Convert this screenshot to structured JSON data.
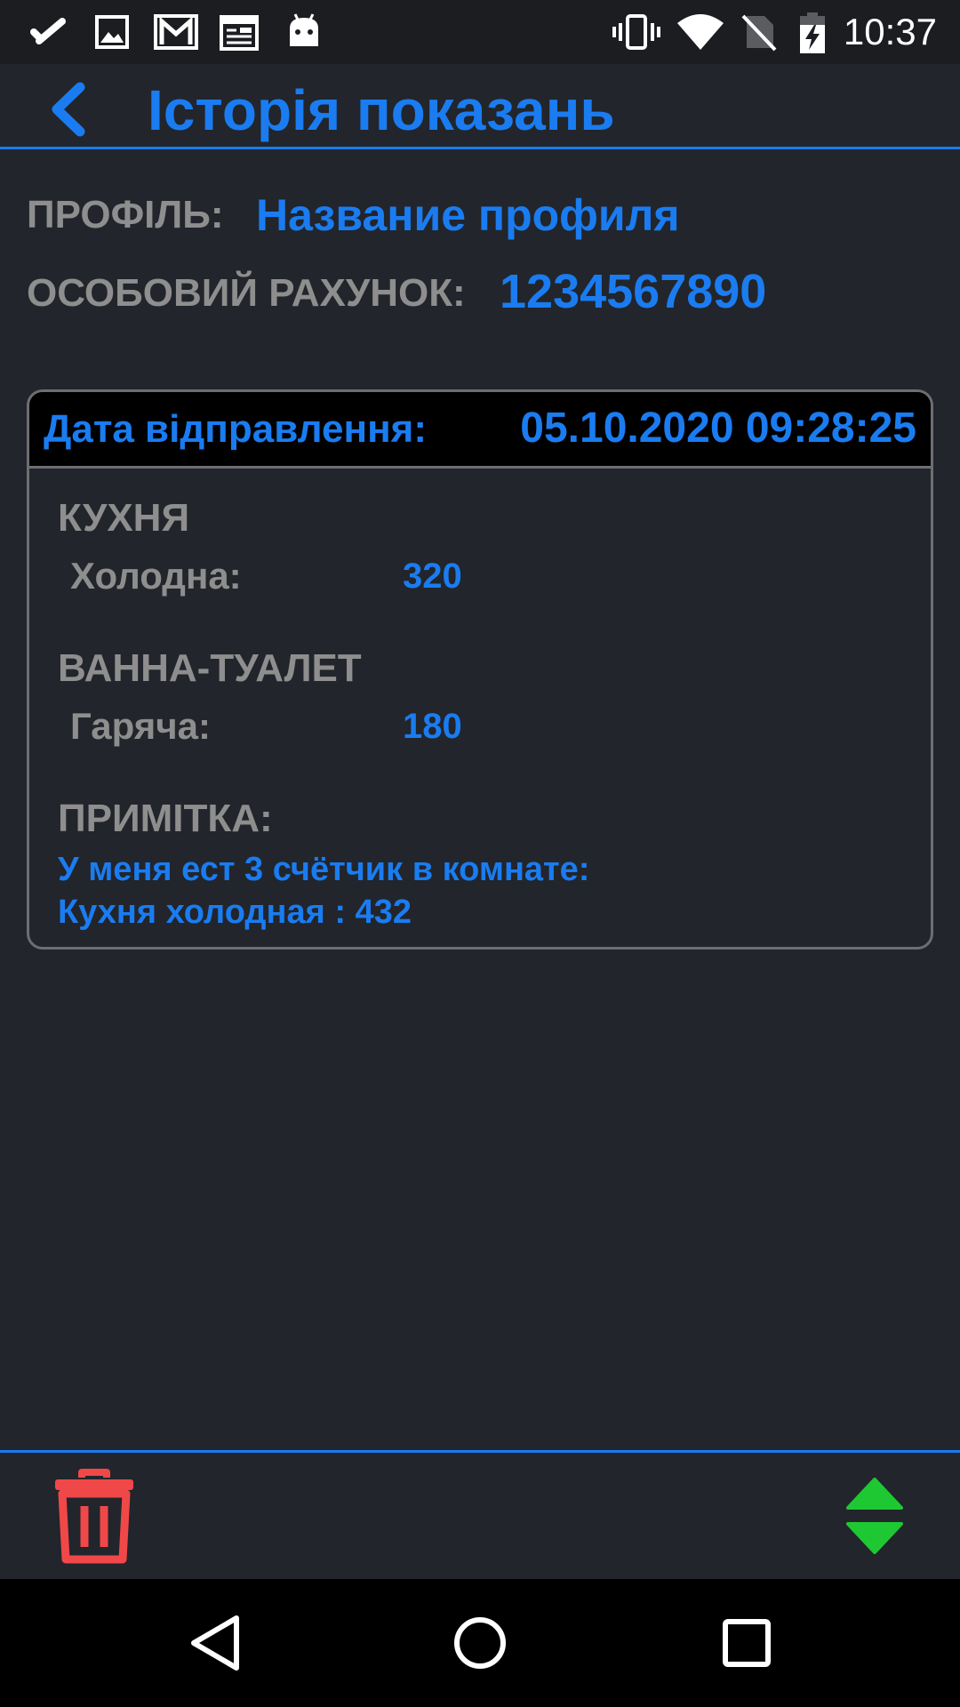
{
  "status_bar": {
    "time": "10:37",
    "left_icons": [
      "check-icon",
      "gallery-icon",
      "gmail-icon",
      "calendar-icon",
      "android-icon"
    ],
    "right_icons": [
      "vibrate-icon",
      "wifi-icon",
      "no-sim-icon",
      "battery-charging-icon"
    ]
  },
  "app_bar": {
    "title": "Історія показань",
    "back_icon": "chevron-left-icon"
  },
  "profile": {
    "profile_label": "ПРОФІЛЬ:",
    "profile_value": "Название профиля",
    "account_label": "ОСОБОВИЙ РАХУНОК:",
    "account_value": "1234567890"
  },
  "record": {
    "sent_label": "Дата відправлення:",
    "sent_value": "05.10.2020 09:28:25",
    "rooms": [
      {
        "name": "КУХНЯ",
        "meter_label": "Холодна:",
        "meter_value": "320"
      },
      {
        "name": "ВАННА-ТУАЛЕТ",
        "meter_label": "Гаряча:",
        "meter_value": "180"
      }
    ],
    "note_label": "ПРИМІТКА:",
    "note_lines": [
      "У меня ест 3 счётчик в комнате:",
      "Кухня холодная : 432"
    ]
  },
  "bottom_bar": {
    "delete_icon": "trash-icon",
    "sort_icon": "sort-arrows-icon"
  },
  "nav_bar": {
    "back": "nav-back-icon",
    "home": "nav-home-icon",
    "recents": "nav-recents-icon"
  },
  "colors": {
    "accent": "#1a7cf0",
    "background": "#22252b",
    "label_gray": "#8e8e8e",
    "delete_red": "#f04848",
    "sort_green": "#1ec832"
  }
}
